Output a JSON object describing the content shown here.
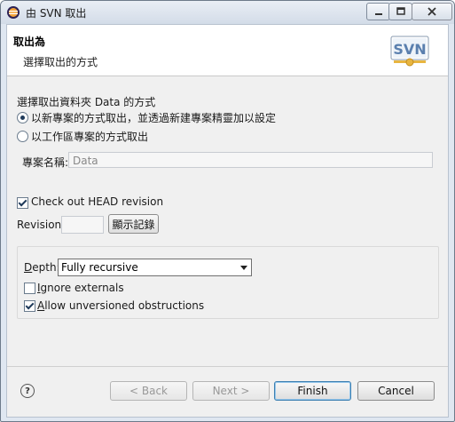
{
  "window": {
    "title": "由 SVN 取出"
  },
  "header": {
    "title": "取出為",
    "description": "選擇取出的方式",
    "logo_text": "SVN"
  },
  "checkout_method": {
    "label": "選擇取出資料夾 Data 的方式",
    "options": [
      {
        "label": "以新專案的方式取出，並透過新建專案精靈加以設定",
        "selected": true
      },
      {
        "label": "以工作區專案的方式取出",
        "selected": false
      }
    ]
  },
  "project_name": {
    "label": "專案名稱:",
    "value": "Data"
  },
  "revision": {
    "head_label": "Check out HEAD revision",
    "head_checked": true,
    "label": "Revision:",
    "value": "",
    "show_log_label": "顯示記錄"
  },
  "options": {
    "depth_label_hotkey": "D",
    "depth_label_rest": "epth:",
    "depth_value": "Fully recursive",
    "ignore_hotkey": "I",
    "ignore_rest": "gnore externals",
    "ignore_checked": false,
    "allow_hotkey": "A",
    "allow_rest": "llow unversioned obstructions",
    "allow_checked": true
  },
  "footer": {
    "help_glyph": "?",
    "back_label": "< Back",
    "back_hotkey": "B",
    "next_label": "Next >",
    "finish_label": "Finish",
    "finish_hotkey": "F",
    "cancel_label": "Cancel"
  }
}
